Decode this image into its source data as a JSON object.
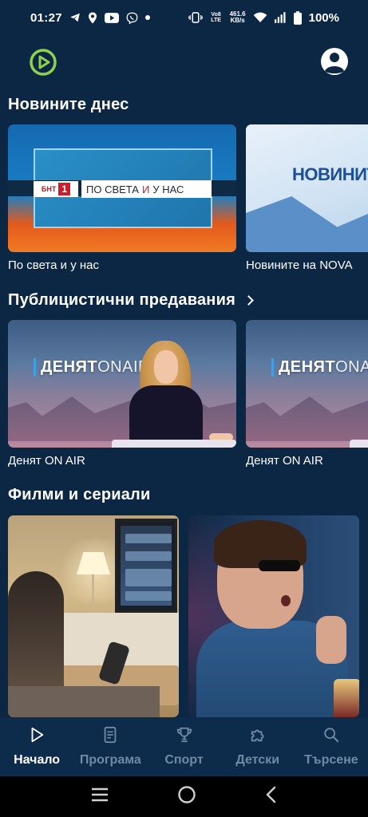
{
  "status_bar": {
    "time": "01:27",
    "left_icons": [
      "telegram-icon",
      "location-icon",
      "youtube-icon",
      "viber-icon",
      "dot-icon"
    ],
    "vo_lte": "Vo8 LTE",
    "net_speed_value": "461.6",
    "net_speed_unit": "KB/s",
    "battery": "100%"
  },
  "app_bar": {
    "logo_icon": "play-logo-icon",
    "profile_icon": "account-circle-icon",
    "accent_color": "#8fd14f"
  },
  "sections": {
    "news": {
      "title": "Новините днес",
      "items": [
        {
          "label": "По света и у нас",
          "thumb_channel": "БНТ",
          "thumb_channel_number": "1",
          "thumb_text_a": "ПО СВЕТА",
          "thumb_text_red": "И",
          "thumb_text_b": "У НАС"
        },
        {
          "label": "Новините на NOVA",
          "thumb_word": "НОВИНИТ"
        }
      ]
    },
    "public": {
      "title": "Публицистични предавания",
      "items": [
        {
          "label": "Денят ON AIR",
          "thumb_logo": "ДЕНЯТ",
          "thumb_logo_suffix": "ONAIR"
        },
        {
          "label": "Денят ON AIR",
          "thumb_logo": "ДЕНЯТ",
          "thumb_logo_suffix": "ONAIR"
        }
      ]
    },
    "films": {
      "title": "Филми и сериали"
    }
  },
  "bottom_nav": {
    "active_color": "#ffffff",
    "inactive_color": "#6f8aa6",
    "items": [
      {
        "label": "Начало",
        "icon": "play-icon",
        "active": true
      },
      {
        "label": "Програма",
        "icon": "document-icon",
        "active": false
      },
      {
        "label": "Спорт",
        "icon": "trophy-icon",
        "active": false
      },
      {
        "label": "Детски",
        "icon": "puzzle-icon",
        "active": false
      },
      {
        "label": "Търсене",
        "icon": "search-icon",
        "active": false
      }
    ]
  },
  "system_nav": {
    "icons": [
      "recent-apps-icon",
      "home-icon",
      "back-icon"
    ]
  }
}
